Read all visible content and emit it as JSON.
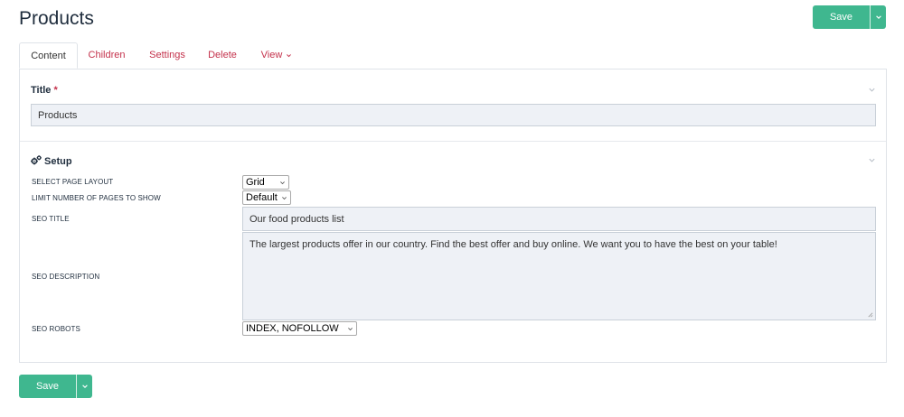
{
  "page": {
    "title": "Products"
  },
  "actions": {
    "save_label": "Save"
  },
  "tabs": [
    {
      "label": "Content",
      "active": true
    },
    {
      "label": "Children",
      "active": false
    },
    {
      "label": "Settings",
      "active": false
    },
    {
      "label": "Delete",
      "active": false
    },
    {
      "label": "View",
      "active": false,
      "dropdown": true
    }
  ],
  "title_section": {
    "heading": "Title",
    "required_marker": "*",
    "value": "Products"
  },
  "setup_section": {
    "heading": "Setup",
    "icon": "gears-icon",
    "fields": {
      "layout": {
        "label": "SELECT PAGE LAYOUT",
        "value": "Grid"
      },
      "pages_limit": {
        "label": "LIMIT NUMBER OF PAGES TO SHOW",
        "value": "Default"
      },
      "seo_title": {
        "label": "SEO TITLE",
        "value": "Our food products list"
      },
      "seo_description": {
        "label": "SEO DESCRIPTION",
        "value": "The largest products offer in our country. Find the best offer and buy online. We want you to have the best on your table!"
      },
      "seo_robots": {
        "label": "SEO ROBOTS",
        "value": "INDEX, NOFOLLOW"
      }
    }
  },
  "colors": {
    "accent_green": "#3fb78f",
    "tab_link": "#c4314b",
    "input_bg": "#eef1f6"
  }
}
